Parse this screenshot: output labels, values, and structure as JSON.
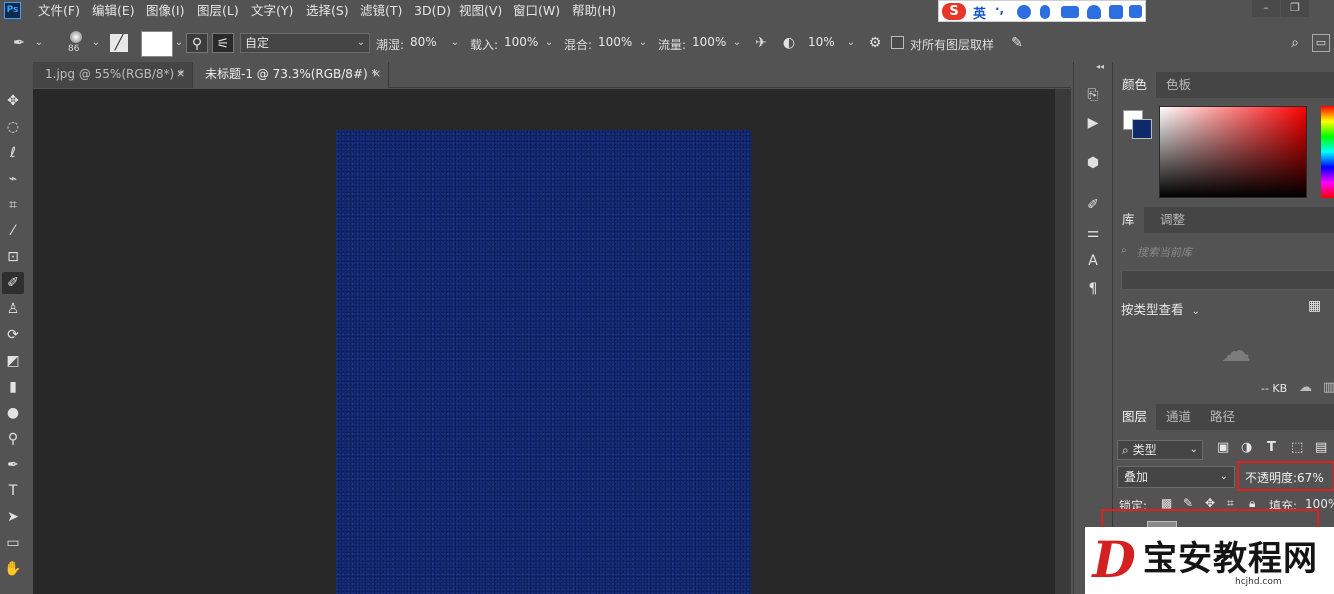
{
  "menu": {
    "logo": "Ps",
    "items": [
      "文件(F)",
      "编辑(E)",
      "图像(I)",
      "图层(L)",
      "文字(Y)",
      "选择(S)",
      "滤镜(T)",
      "3D(D)",
      "视图(V)",
      "窗口(W)",
      "帮助(H)"
    ]
  },
  "ime": {
    "logo": "S",
    "lang": "英",
    "punct": "·,",
    "icons": [
      "emoji-icon",
      "microphone-icon",
      "keyboard-icon",
      "user-icon",
      "tshirt-icon",
      "apps-icon"
    ]
  },
  "window_controls": [
    "–",
    "❐"
  ],
  "options": {
    "brush_size": "86",
    "preset": "自定",
    "wet_label": "潮湿:",
    "wet_value": "80%",
    "load_label": "载入:",
    "load_value": "100%",
    "mix_label": "混合:",
    "mix_value": "100%",
    "flow_label": "流量:",
    "flow_value": "100%",
    "smooth_value": "10%",
    "sample_all_label": "对所有图层取样"
  },
  "tabs": [
    {
      "label": "1.jpg @ 55%(RGB/8*) *",
      "close": "×",
      "active": false
    },
    {
      "label": "未标题-1 @ 73.3%(RGB/8#) *",
      "close": "×",
      "active": true
    }
  ],
  "panels": {
    "collapse_glyph": "◂◂",
    "color_tabs": [
      "颜色",
      "色板"
    ],
    "library_tabs": [
      "库",
      "调整"
    ],
    "library_search_placeholder": "搜索当前库",
    "library_view_label": "按类型查看",
    "library_size": "-- KB",
    "layer_tabs": [
      "图层",
      "通道",
      "路径"
    ],
    "layer_filter": "类型",
    "blend_mode": "叠加",
    "opacity_label": "不透明度:",
    "opacity_value": "67%",
    "lock_label": "锁定:",
    "fill_label": "填充:",
    "fill_value": "100%"
  },
  "colors": {
    "foreground": "#ffffff",
    "background": "#0d2a6b",
    "canvas_fill": "#0d2264",
    "highlight": "#e02020"
  },
  "watermark": {
    "logo": "D",
    "title": "宝安教程网",
    "url": "hcjhd.com"
  }
}
